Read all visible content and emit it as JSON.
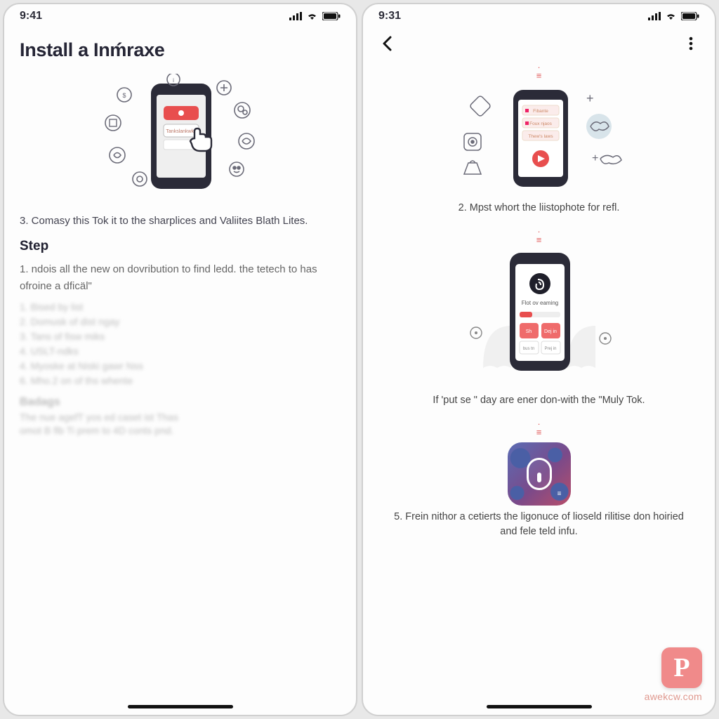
{
  "left": {
    "status_time": "9:41",
    "title": "Install a Inḿraxe",
    "step3": "3. Comasy this Tok it to the sharplices and Valiites Blath Lites.",
    "step_heading": "Step",
    "step_intro": "1. ndois all the new on dovribution to find ledd. the tetech to has ofroine a dficäl\"",
    "blur_items": [
      "1. Bised by list",
      "2. Domusk of dist ngay",
      "3. Tans of fisw miks",
      "4. USLT-ndks",
      "4. Myoske at Niski gawr Nss",
      "6. Mho.2 on of ths whente"
    ],
    "blur_heading": "Badags",
    "blur_para": [
      "The nue agefT yos ed caset ist Thas",
      "omot B flb Ti prem to 4D conts pnd."
    ]
  },
  "right": {
    "status_time": "9:31",
    "caption2": "2. Mpst whort the liistophote for refl.",
    "caption_mid": "If 'put se \" day are ener don-with the \"Muly Tok.",
    "caption5": "5. Frein nithor a cetierts the ligonuce of lioseld rilitise don hoiried and fele teld infu.",
    "phone2_label": "Flot ov eaming"
  },
  "watermark": "awekcw.com",
  "p_badge": "P"
}
